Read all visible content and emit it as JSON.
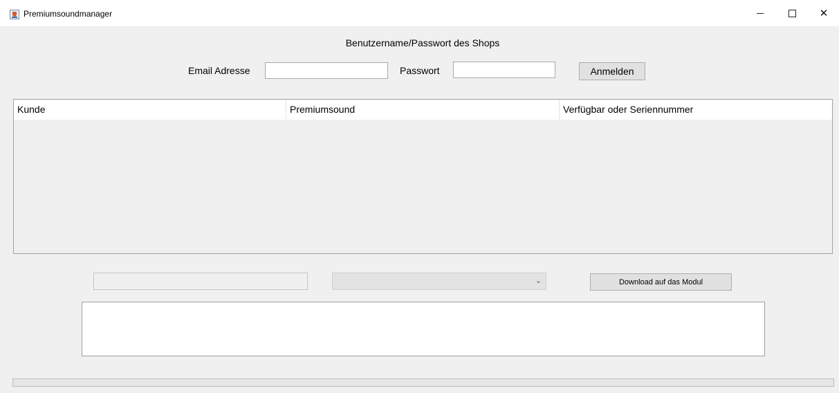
{
  "window": {
    "title": "Premiumsoundmanager",
    "icon": "java-cup-icon"
  },
  "login": {
    "heading": "Benutzername/Passwort des Shops",
    "email_label": "Email Adresse",
    "email_value": "",
    "password_label": "Passwort",
    "password_value": "",
    "login_button": "Anmelden"
  },
  "table": {
    "columns": [
      "Kunde",
      "Premiumsound",
      "Verfügbar oder Seriennummer"
    ],
    "rows": []
  },
  "module": {
    "serial_field_value": "",
    "select_value": "",
    "download_button": "Download auf das Modul"
  },
  "log": {
    "text": ""
  },
  "progress": {
    "fraction": 0
  }
}
